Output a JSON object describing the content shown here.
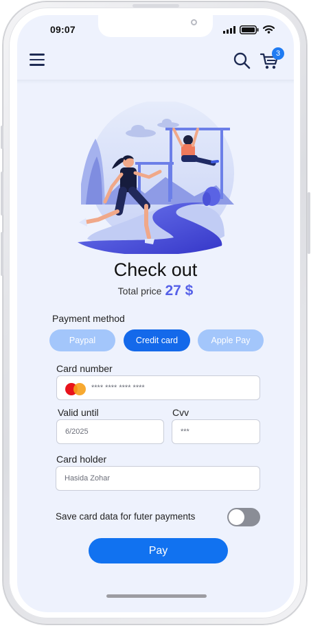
{
  "status_bar": {
    "time": "09:07"
  },
  "header": {
    "cart_count": "3"
  },
  "checkout": {
    "title": "Check out",
    "price_label": "Total price",
    "price_value": "27 $"
  },
  "payment": {
    "section_label": "Payment method",
    "methods": [
      {
        "label": "Paypal",
        "selected": false
      },
      {
        "label": "Credit card",
        "selected": true
      },
      {
        "label": "Apple Pay",
        "selected": false
      }
    ]
  },
  "form": {
    "card_number": {
      "label": "Card number",
      "value": "**** **** **** ****"
    },
    "valid_until": {
      "label": "Valid until",
      "value": "6/2025"
    },
    "cvv": {
      "label": "Cvv",
      "value": "***"
    },
    "card_holder": {
      "label": "Card holder",
      "value": "Hasida Zohar"
    }
  },
  "save_card": {
    "label": "Save card data for futer payments",
    "enabled": false
  },
  "pay_button": {
    "label": "Pay"
  },
  "colors": {
    "screen_bg": "#eef2fd",
    "accent": "#1469ea",
    "price": "#5560e8",
    "method_unselected": "#a3c6fb",
    "toggle_off": "#8a8d96"
  },
  "icons": [
    "menu-icon",
    "search-icon",
    "cart-icon",
    "signal-icon",
    "battery-icon",
    "wifi-icon",
    "mastercard-icon"
  ]
}
